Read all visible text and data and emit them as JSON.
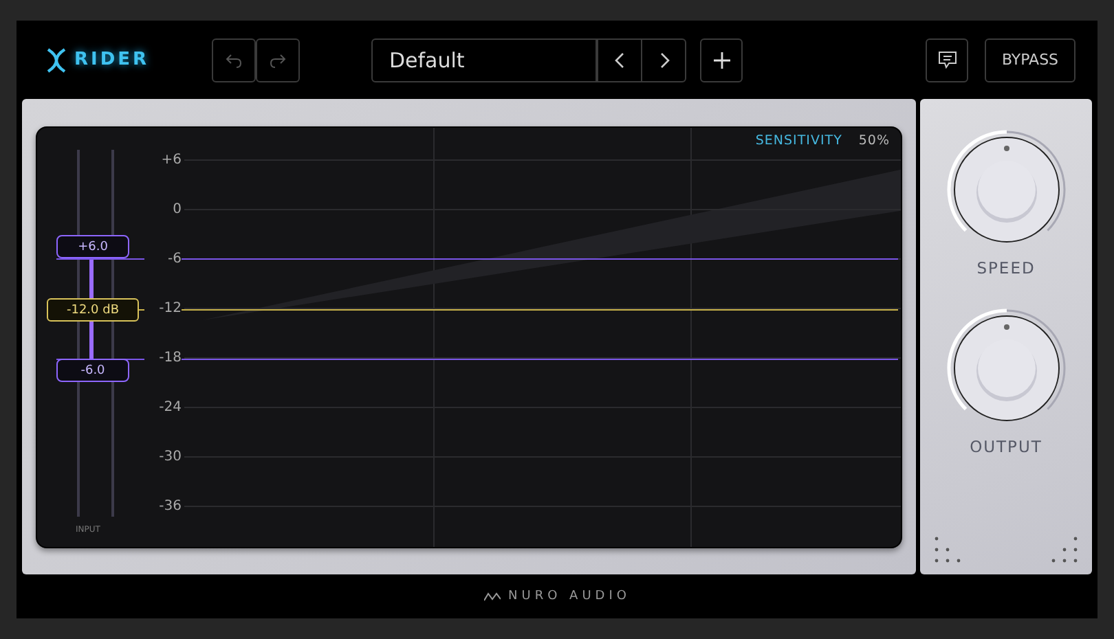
{
  "header": {
    "logo": "RIDER",
    "undo": {
      "disabled": true
    },
    "redo": {
      "disabled": true
    },
    "preset": "Default",
    "bypass": "BYPASS"
  },
  "graph": {
    "sensitivity_label": "SENSITIVITY",
    "sensitivity_value": "50%",
    "scale": [
      "+6",
      "0",
      "-6",
      "-12",
      "-18",
      "-24",
      "-30",
      "-36"
    ],
    "fader": {
      "upper": "+6.0",
      "target": "-12.0 dB",
      "lower": "-6.0",
      "label": "INPUT"
    }
  },
  "knobs": [
    {
      "label": "SPEED",
      "level": 0.5
    },
    {
      "label": "OUTPUT",
      "level": 0.5
    }
  ],
  "footer": "NURO AUDIO"
}
